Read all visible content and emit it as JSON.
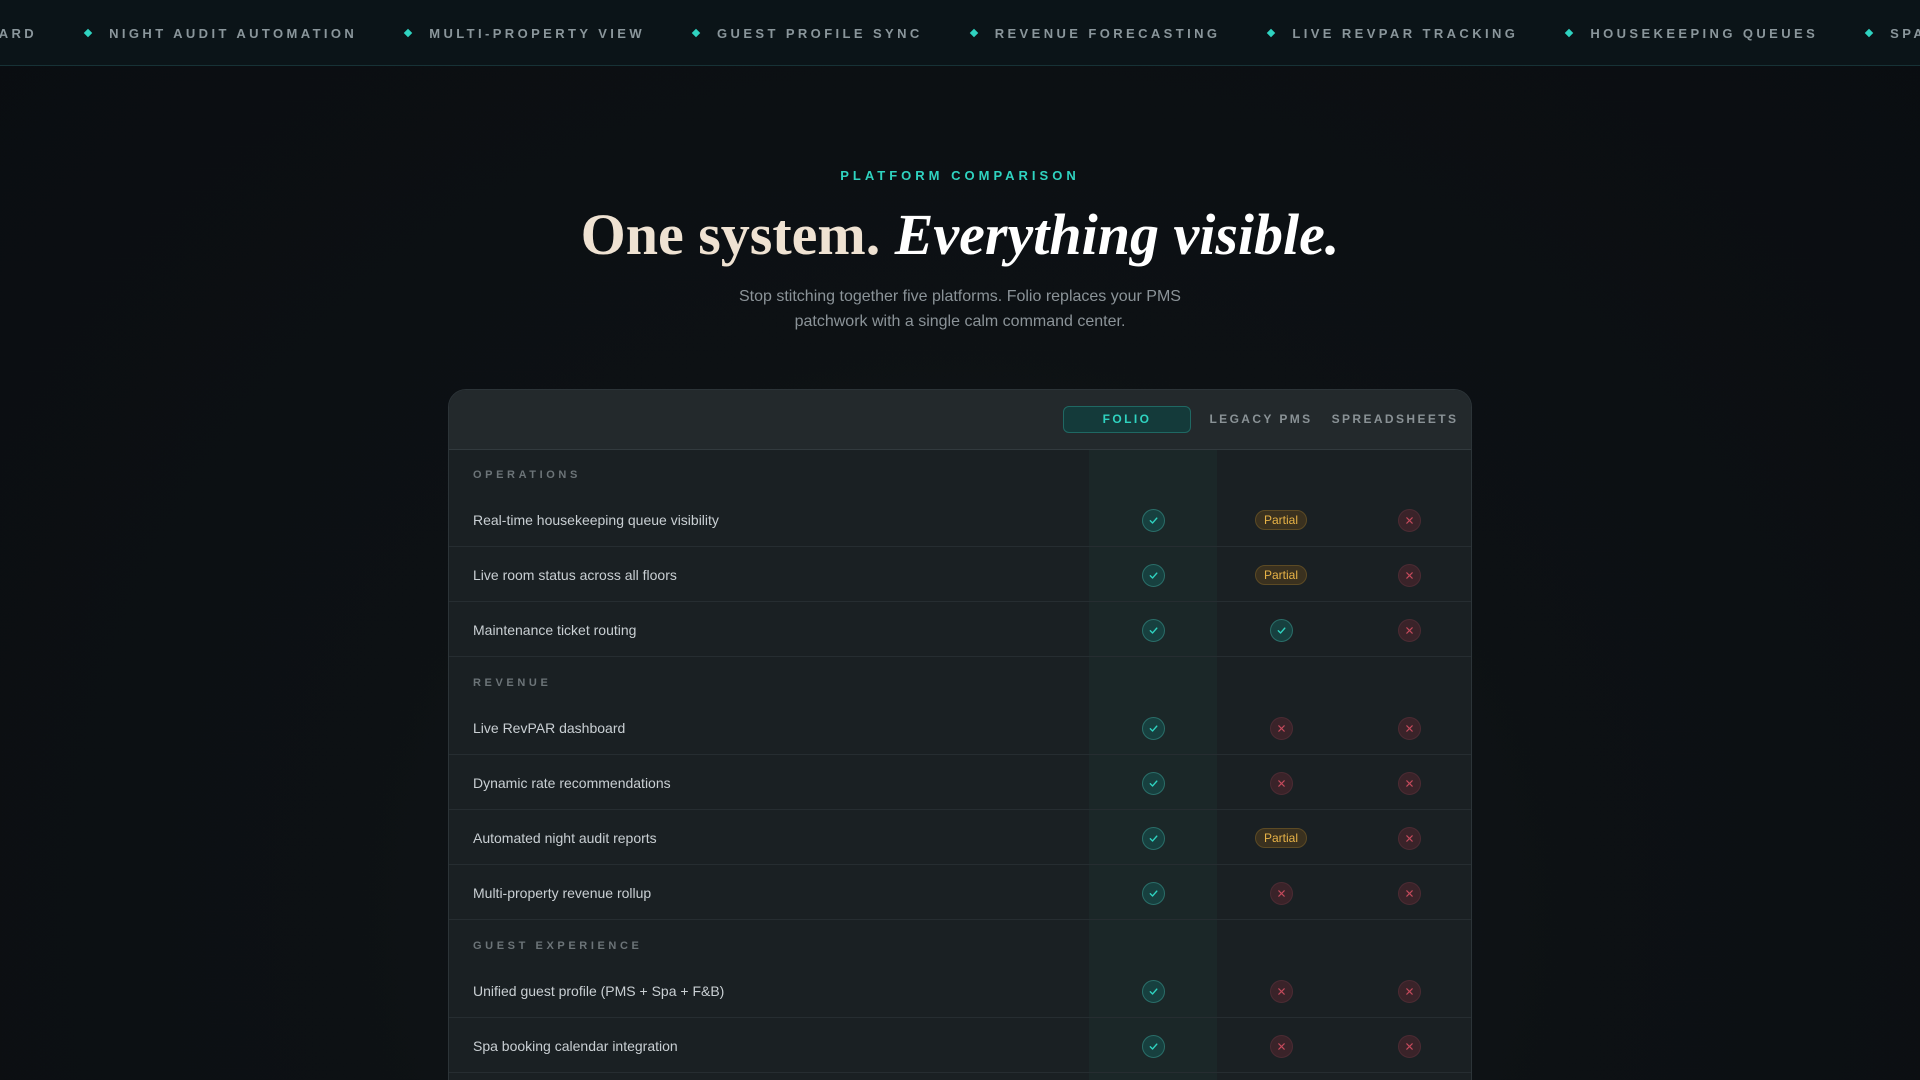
{
  "ticker": {
    "items": [
      "DASHBOARD",
      "NIGHT AUDIT AUTOMATION",
      "MULTI-PROPERTY VIEW",
      "GUEST PROFILE SYNC",
      "REVENUE FORECASTING",
      "LIVE REVPAR TRACKING",
      "HOUSEKEEPING QUEUES",
      "SPA BOOKINGS"
    ],
    "accent": "#2fd3c0"
  },
  "hero": {
    "eyebrow": "PLATFORM COMPARISON",
    "title_plain": "One system.",
    "title_em": "Everything visible.",
    "subtitle": "Stop stitching together five platforms. Folio replaces your PMS patchwork with a single calm command center."
  },
  "table": {
    "columns": [
      "FOLIO",
      "LEGACY PMS",
      "SPREADSHEETS"
    ],
    "partial_label": "Partial",
    "sections": [
      {
        "label": "OPERATIONS",
        "rows": [
          {
            "label": "Real-time housekeeping queue visibility",
            "values": [
              "yes",
              "partial",
              "no"
            ]
          },
          {
            "label": "Live room status across all floors",
            "values": [
              "yes",
              "partial",
              "no"
            ]
          },
          {
            "label": "Maintenance ticket routing",
            "values": [
              "yes",
              "yes",
              "no"
            ]
          }
        ]
      },
      {
        "label": "REVENUE",
        "rows": [
          {
            "label": "Live RevPAR dashboard",
            "values": [
              "yes",
              "no",
              "no"
            ]
          },
          {
            "label": "Dynamic rate recommendations",
            "values": [
              "yes",
              "no",
              "no"
            ]
          },
          {
            "label": "Automated night audit reports",
            "values": [
              "yes",
              "partial",
              "no"
            ]
          },
          {
            "label": "Multi-property revenue rollup",
            "values": [
              "yes",
              "no",
              "no"
            ]
          }
        ]
      },
      {
        "label": "GUEST EXPERIENCE",
        "rows": [
          {
            "label": "Unified guest profile (PMS + Spa + F&B)",
            "values": [
              "yes",
              "no",
              "no"
            ]
          },
          {
            "label": "Spa booking calendar integration",
            "values": [
              "yes",
              "no",
              "no"
            ]
          }
        ]
      }
    ]
  },
  "colors": {
    "accent": "#2fd3c0",
    "yes": "#2fd3c0",
    "no": "#c44a5c",
    "partial": "#e8b347"
  }
}
